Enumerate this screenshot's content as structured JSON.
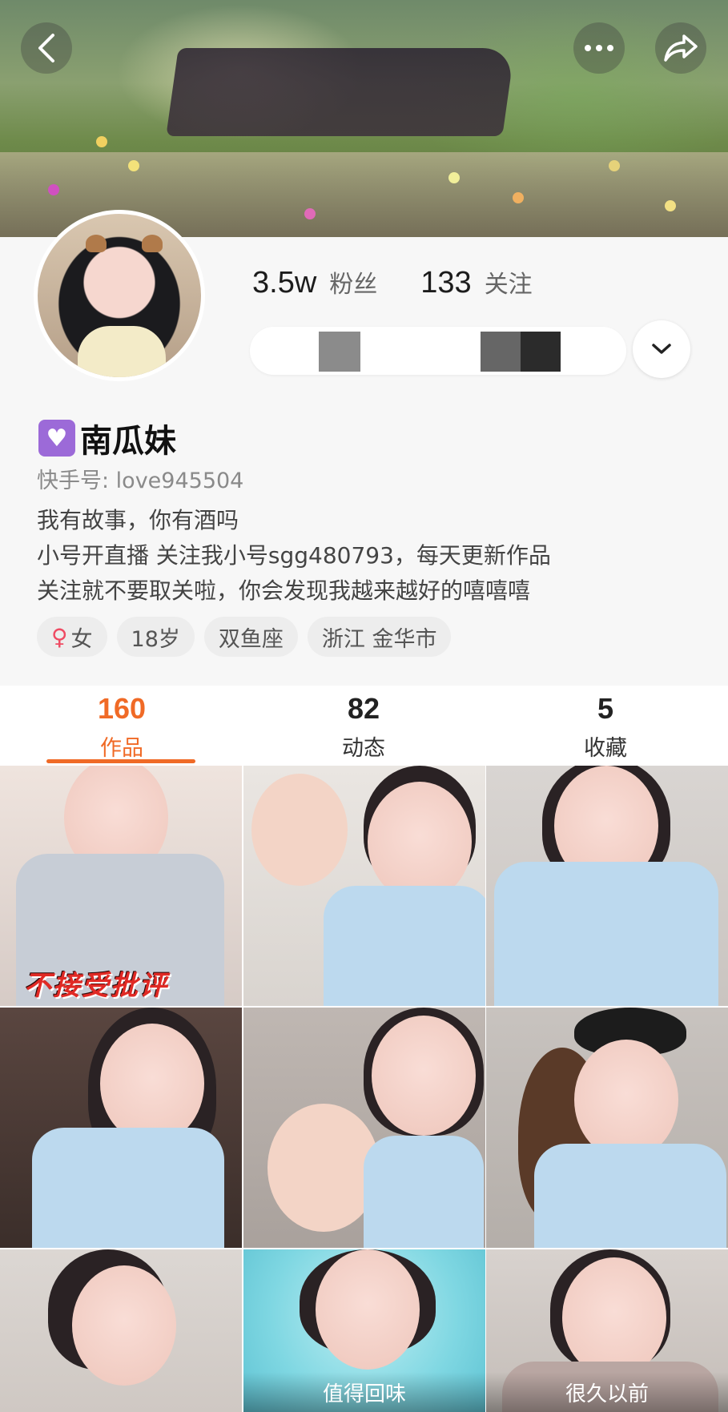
{
  "header": {
    "back_icon": "back-arrow-icon",
    "more_icon": "more-dots-icon",
    "share_icon": "share-icon"
  },
  "profile": {
    "followers_count": "3.5w",
    "followers_label": "粉丝",
    "following_count": "133",
    "following_label": "关注",
    "badge_icon": "purple-heart-icon",
    "badge_glyph": "♥",
    "name": "南瓜妹",
    "kuaishou_id": "快手号: love945504",
    "bio": [
      "我有故事，你有酒吗",
      "小号开直播 关注我小号sgg480793，每天更新作品",
      "关注就不要取关啦，你会发现我越来越好的嘻嘻嘻"
    ],
    "tags": {
      "gender_symbol": "♀",
      "gender": "女",
      "age": "18岁",
      "zodiac": "双鱼座",
      "location": "浙江 金华市"
    }
  },
  "tabs": {
    "works": {
      "count": "160",
      "label": "作品"
    },
    "moments": {
      "count": "82",
      "label": "动态"
    },
    "saved": {
      "count": "5",
      "label": "收藏"
    },
    "active": "works"
  },
  "grid": {
    "items": [
      {
        "overlay": "不接受批评"
      },
      {},
      {},
      {},
      {},
      {},
      {},
      {
        "caption": "值得回味"
      },
      {
        "caption": "很久以前"
      }
    ]
  },
  "colors": {
    "accent": "#f06a26",
    "badge": "#9c6ad8",
    "female": "#ef4b63"
  }
}
